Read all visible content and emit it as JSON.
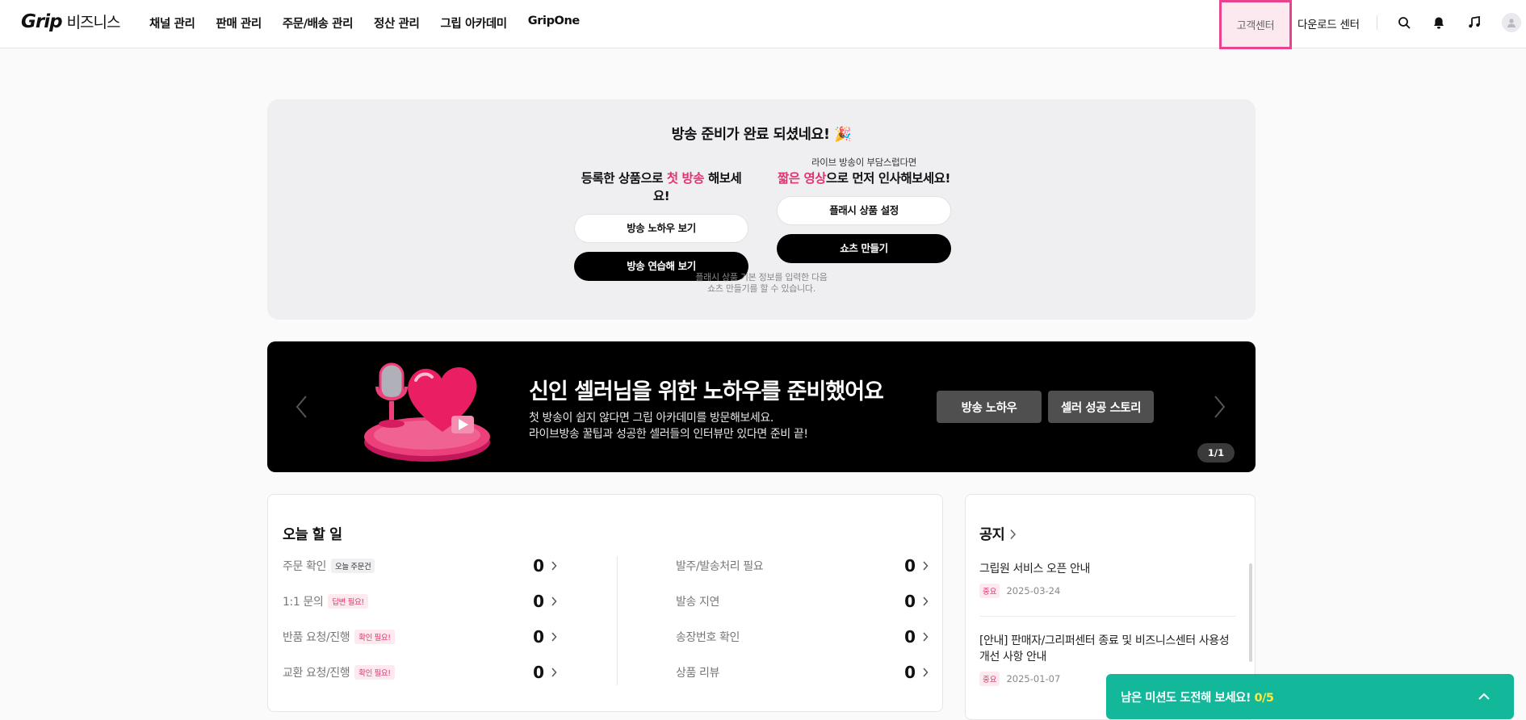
{
  "header": {
    "logo_brand": "Grip",
    "logo_biz": "비즈니스",
    "nav": [
      "채널 관리",
      "판매 관리",
      "주문/배송 관리",
      "정산 관리",
      "그립 아카데미",
      "GripOne"
    ],
    "customer_center": "고객센터",
    "download_center": "다운로드 센터",
    "icons": [
      "search-icon",
      "bell-icon",
      "music-icon",
      "avatar-icon"
    ]
  },
  "ready_card": {
    "title": "방송 준비가 완료 되셨네요! 🎉",
    "left": {
      "head_pre": "등록한 상품으로 ",
      "head_em": "첫 방송",
      "head_post": " 해보세요!",
      "btn_white": "방송 노하우 보기",
      "btn_black": "방송 연습해 보기"
    },
    "right": {
      "sub": "라이브 방송이 부담스럽다면",
      "head_em": "짧은 영상",
      "head_post": "으로 먼저 인사해보세요!",
      "btn_white": "플래시 상품 설정",
      "btn_black": "쇼츠 만들기"
    },
    "note_line1": "플래시 상품 기본 정보를 입력한 다음",
    "note_line2": "쇼츠 만들기를 할 수 있습니다."
  },
  "banner": {
    "title": "신인 셀러님을 위한 노하우를 준비했어요",
    "desc_line1": "첫 방송이 쉽지 않다면 그립 아카데미를 방문해보세요.",
    "desc_line2": "라이브방송 꿀팁과 성공한 셀러들의 인터뷰만 있다면 준비 끝!",
    "btn1": "방송 노하우",
    "btn2": "셀러 성공 스토리",
    "pager": "1/1"
  },
  "todo": {
    "title": "오늘 할 일",
    "left": [
      {
        "label": "주문 확인",
        "tag": "오늘 주문건",
        "tag_style": "gray",
        "count": "0"
      },
      {
        "label": "1:1 문의",
        "tag": "답변 필요!",
        "tag_style": "red",
        "count": "0"
      },
      {
        "label": "반품 요청/진행",
        "tag": "확인 필요!",
        "tag_style": "red",
        "count": "0"
      },
      {
        "label": "교환 요청/진행",
        "tag": "확인 필요!",
        "tag_style": "red",
        "count": "0"
      }
    ],
    "right": [
      {
        "label": "발주/발송처리 필요",
        "count": "0"
      },
      {
        "label": "발송 지연",
        "count": "0"
      },
      {
        "label": "송장번호 확인",
        "count": "0"
      },
      {
        "label": "상품 리뷰",
        "count": "0"
      }
    ]
  },
  "notice": {
    "title": "공지",
    "items": [
      {
        "title": "그립원 서비스 오픈 안내",
        "badge": "중요",
        "date": "2025-03-24"
      },
      {
        "title": "[안내] 판매자/그리퍼센터 종료 및 비즈니스센터 사용성 개선 사항 안내",
        "badge": "중요",
        "date": "2025-01-07"
      }
    ]
  },
  "mission": {
    "text": "남은 미션도 도전해 보세요! ",
    "progress": "0/5"
  },
  "colors": {
    "accent_pink": "#e0356f",
    "highlight_border": "#e9438f",
    "mission_green": "#13b89a",
    "mission_yellow": "#f6e94a"
  }
}
